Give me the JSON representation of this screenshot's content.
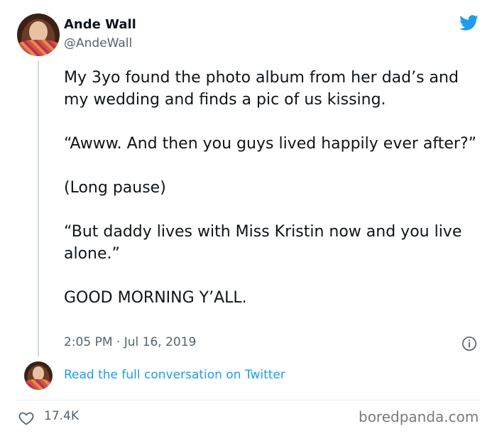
{
  "author": {
    "display_name": "Ande Wall",
    "handle": "@AndeWall"
  },
  "tweet": {
    "paragraphs": [
      "My 3yo found the photo album from her dad’s and my wedding and finds a pic of us kissing.",
      "“Awww. And then you guys lived happily ever after?”",
      "(Long pause)",
      "“But daddy lives with Miss Kristin now and you live alone.”",
      "GOOD MORNING Y’ALL."
    ],
    "timestamp": "2:05 PM · Jul 16, 2019"
  },
  "conversation_link": "Read the full conversation on Twitter",
  "likes": "17.4K",
  "watermark": "boredpanda.com",
  "icons": {
    "brand": "twitter-bird-icon",
    "info": "info-icon",
    "like": "heart-icon"
  },
  "colors": {
    "twitter_blue": "#1d9bf0",
    "secondary_text": "#536471",
    "thread_line": "#cfd9de"
  }
}
